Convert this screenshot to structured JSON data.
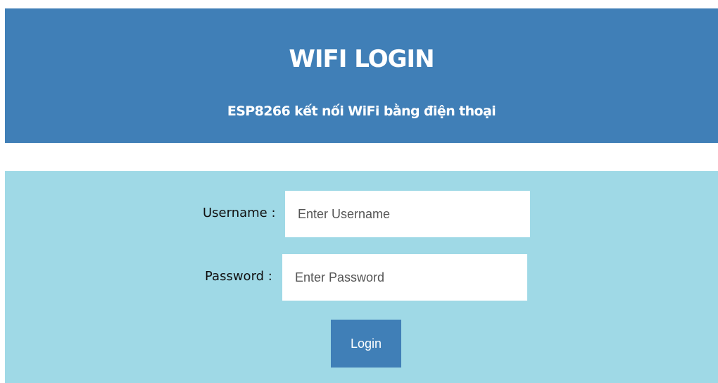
{
  "header": {
    "title": "WIFI LOGIN",
    "subtitle": "ESP8266 kết nối WiFi bằng điện thoại"
  },
  "form": {
    "username_label": "Username :",
    "username_placeholder": "Enter Username",
    "username_value": "",
    "password_label": "Password :",
    "password_placeholder": "Enter Password",
    "password_value": "",
    "login_label": "Login"
  },
  "colors": {
    "header_bg": "#407fb7",
    "panel_bg": "#9fd9e6",
    "button_bg": "#407fb7",
    "text_on_blue": "#ffffff"
  }
}
